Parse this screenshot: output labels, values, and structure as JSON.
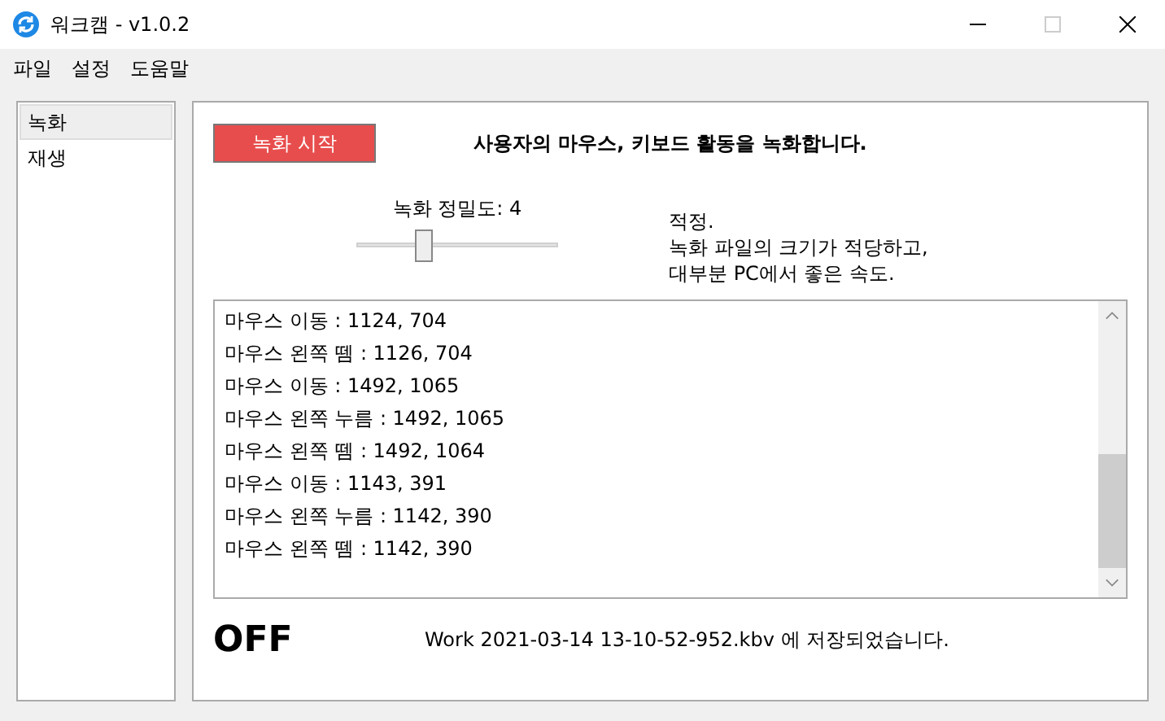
{
  "window": {
    "title": "워크캠 - v1.0.2",
    "maximize_disabled": true
  },
  "menu": [
    "파일",
    "설정",
    "도움말"
  ],
  "sidebar": {
    "items": [
      {
        "label": "녹화",
        "selected": true
      },
      {
        "label": "재생",
        "selected": false
      }
    ]
  },
  "record_button": "녹화 시작",
  "heading": "사용자의 마우스, 키보드 활동을 녹화합니다.",
  "precision": {
    "label": "녹화 정밀도: 4",
    "level": 0.33,
    "description": [
      "적정.",
      "녹화 파일의 크기가 적당하고,",
      "대부분 PC에서 좋은 속도."
    ]
  },
  "log": [
    "마우스 이동 : 1124, 704",
    "마우스 왼쪽 뗌 : 1126, 704",
    "마우스 이동 : 1492, 1065",
    "마우스 왼쪽 누름 : 1492, 1065",
    "마우스 왼쪽 뗌 : 1492, 1064",
    "마우스 이동 : 1143, 391",
    "마우스 왼쪽 누름 : 1142, 390",
    "마우스 왼쪽 뗌 : 1142, 390"
  ],
  "state": "OFF",
  "status": "Work 2021-03-14 13-10-52-952.kbv 에 저장되었습니다."
}
